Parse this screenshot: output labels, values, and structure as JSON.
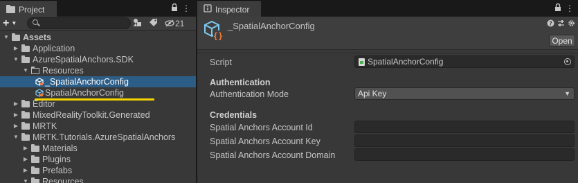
{
  "project": {
    "tab_label": "Project",
    "hidden_count": "21",
    "search": {
      "value": "",
      "placeholder": ""
    },
    "tree": [
      {
        "label": "Assets",
        "indent": 0,
        "expanded": true,
        "type": "folder",
        "bold": true
      },
      {
        "label": "Application",
        "indent": 1,
        "expanded": false,
        "type": "folder"
      },
      {
        "label": "AzureSpatialAnchors.SDK",
        "indent": 1,
        "expanded": true,
        "type": "folder"
      },
      {
        "label": "Resources",
        "indent": 2,
        "expanded": true,
        "type": "folder-open"
      },
      {
        "label": "_SpatialAnchorConfig",
        "indent": 3,
        "type": "asset",
        "selected": true
      },
      {
        "label": "SpatialAnchorConfig",
        "indent": 3,
        "type": "asset"
      },
      {
        "label": "Editor",
        "indent": 1,
        "expanded": false,
        "type": "folder"
      },
      {
        "label": "MixedRealityToolkit.Generated",
        "indent": 1,
        "expanded": false,
        "type": "folder"
      },
      {
        "label": "MRTK",
        "indent": 1,
        "expanded": false,
        "type": "folder"
      },
      {
        "label": "MRTK.Tutorials.AzureSpatialAnchors",
        "indent": 1,
        "expanded": true,
        "type": "folder"
      },
      {
        "label": "Materials",
        "indent": 2,
        "expanded": false,
        "type": "folder"
      },
      {
        "label": "Plugins",
        "indent": 2,
        "expanded": false,
        "type": "folder"
      },
      {
        "label": "Prefabs",
        "indent": 2,
        "expanded": false,
        "type": "folder"
      },
      {
        "label": "Resources",
        "indent": 2,
        "expanded": true,
        "type": "folder"
      }
    ]
  },
  "inspector": {
    "tab_label": "Inspector",
    "asset_title": "_SpatialAnchorConfig",
    "open_button": "Open",
    "script_label": "Script",
    "script_value": "SpatialAnchorConfig",
    "auth_section": "Authentication",
    "auth_mode_label": "Authentication Mode",
    "auth_mode_value": "Api Key",
    "cred_section": "Credentials",
    "account_id_label": "Spatial Anchors Account Id",
    "account_id_value": "",
    "account_key_label": "Spatial Anchors Account Key",
    "account_key_value": "",
    "account_domain_label": "Spatial Anchors Account Domain",
    "account_domain_value": ""
  },
  "colors": {
    "selection": "#2c5d87",
    "highlight_underline": "#f5d400",
    "panel_bg": "#383838",
    "cube_icon": "#7ec8f2",
    "brace_icon": "#f07a3c"
  }
}
